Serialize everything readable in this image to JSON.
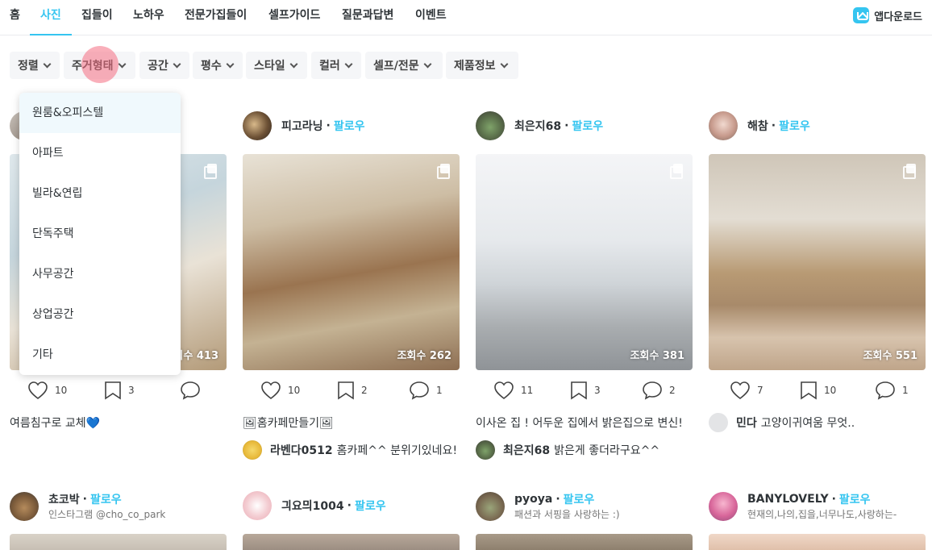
{
  "nav": {
    "tabs": [
      {
        "label": "홈"
      },
      {
        "label": "사진"
      },
      {
        "label": "집들이"
      },
      {
        "label": "노하우"
      },
      {
        "label": "전문가집들이"
      },
      {
        "label": "셀프가이드"
      },
      {
        "label": "질문과답변"
      },
      {
        "label": "이벤트"
      }
    ],
    "active_tab": "사진",
    "app_download": "앱다운로드"
  },
  "filters": [
    {
      "label": "정렬"
    },
    {
      "label": "주거형태"
    },
    {
      "label": "공간"
    },
    {
      "label": "평수"
    },
    {
      "label": "스타일"
    },
    {
      "label": "컬러"
    },
    {
      "label": "셀프/전문"
    },
    {
      "label": "제품정보"
    }
  ],
  "dropdown": {
    "open_for": "주거형태",
    "options": [
      {
        "label": "원룸&오피스텔"
      },
      {
        "label": "아파트"
      },
      {
        "label": "빌라&연립"
      },
      {
        "label": "단독주택"
      },
      {
        "label": "사무공간"
      },
      {
        "label": "상업공간"
      },
      {
        "label": "기타"
      }
    ]
  },
  "cards": [
    {
      "views": "조회수 413",
      "likes": "10",
      "scraps": "3",
      "comments": "",
      "description": "여름침구로 교체💙"
    },
    {
      "author": "피고라닝",
      "dot": "·",
      "follow": "팔로우",
      "views": "조회수 262",
      "likes": "10",
      "scraps": "2",
      "comments": "1",
      "description": "🖼홈카페만들기🖼",
      "comment": {
        "name": "라벤다0512",
        "text": "홈카페^^ 분위기있네요!"
      }
    },
    {
      "author": "최은지68",
      "dot": "·",
      "follow": "팔로우",
      "views": "조회수 381",
      "likes": "11",
      "scraps": "3",
      "comments": "2",
      "description": "이사온 집 ! 어두운 집에서 밝은집으로 변신!",
      "comment": {
        "name": "최은지68",
        "text": "밝은게 좋더라구요^^"
      }
    },
    {
      "author": "해참",
      "dot": "·",
      "follow": "팔로우",
      "views": "조회수 551",
      "likes": "7",
      "scraps": "10",
      "comments": "1",
      "comment": {
        "name": "민다",
        "text": "고양이귀여움 무엇.."
      }
    }
  ],
  "next_row": [
    {
      "author": "쵸코박",
      "dot": "·",
      "follow": "팔로우",
      "bio": "인스타그램 @cho_co_park"
    },
    {
      "author": "긔요믜1004",
      "dot": "·",
      "follow": "팔로우"
    },
    {
      "author": "pyoya",
      "dot": "·",
      "follow": "팔로우",
      "bio": "패션과 서핑을 사랑하는 :)"
    },
    {
      "author": "BANYLOVELY",
      "dot": "·",
      "follow": "팔로우",
      "bio": "현재의,나의,집을,너무나도,사랑하는-"
    }
  ],
  "colors": {
    "accent": "#35c5f0",
    "touch": "#f46e82"
  },
  "icons": [
    "app-download-icon",
    "chevron-down-icon",
    "multi-photo-icon",
    "heart-icon",
    "bookmark-icon",
    "comment-icon"
  ]
}
